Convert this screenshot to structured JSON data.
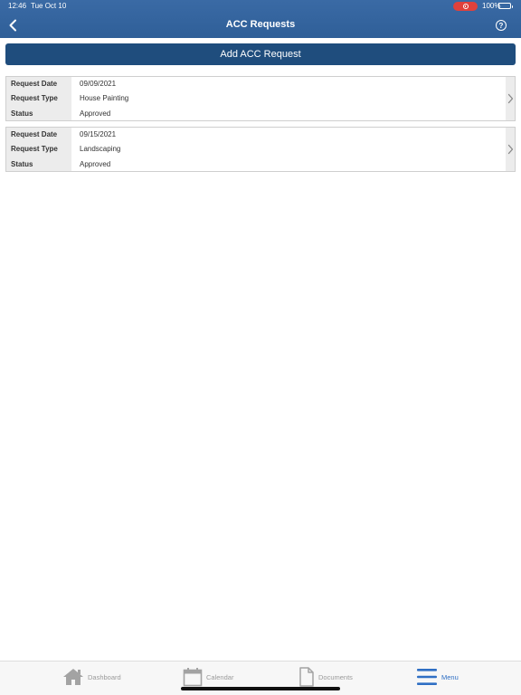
{
  "status_bar": {
    "time": "12:46",
    "date": "Tue Oct 10",
    "battery_percent": "100%",
    "recording_color": "#e0413b",
    "battery_color": "#4cd964"
  },
  "nav": {
    "title": "ACC Requests",
    "back_icon": "chevron-left-icon",
    "help_icon": "question-circle-icon",
    "help_glyph": "?"
  },
  "add_button": {
    "label": "Add ACC Request",
    "color": "#1f4d7d"
  },
  "field_labels": {
    "request_date": "Request Date",
    "request_type": "Request Type",
    "status": "Status"
  },
  "requests": [
    {
      "request_date": "09/09/2021",
      "request_type": "House Painting",
      "status": "Approved"
    },
    {
      "request_date": "09/15/2021",
      "request_type": "Landscaping",
      "status": "Approved"
    }
  ],
  "tab_bar": {
    "tabs": [
      {
        "label": "Dashboard",
        "icon": "home-icon"
      },
      {
        "label": "Calendar",
        "icon": "calendar-icon"
      },
      {
        "label": "Documents",
        "icon": "document-icon"
      },
      {
        "label": "Menu",
        "icon": "menu-icon"
      }
    ],
    "active_tab": "Menu",
    "active_color": "#2f6fc4",
    "inactive_color": "#9a9a9a"
  },
  "colors": {
    "header": "#3a6aa5"
  }
}
